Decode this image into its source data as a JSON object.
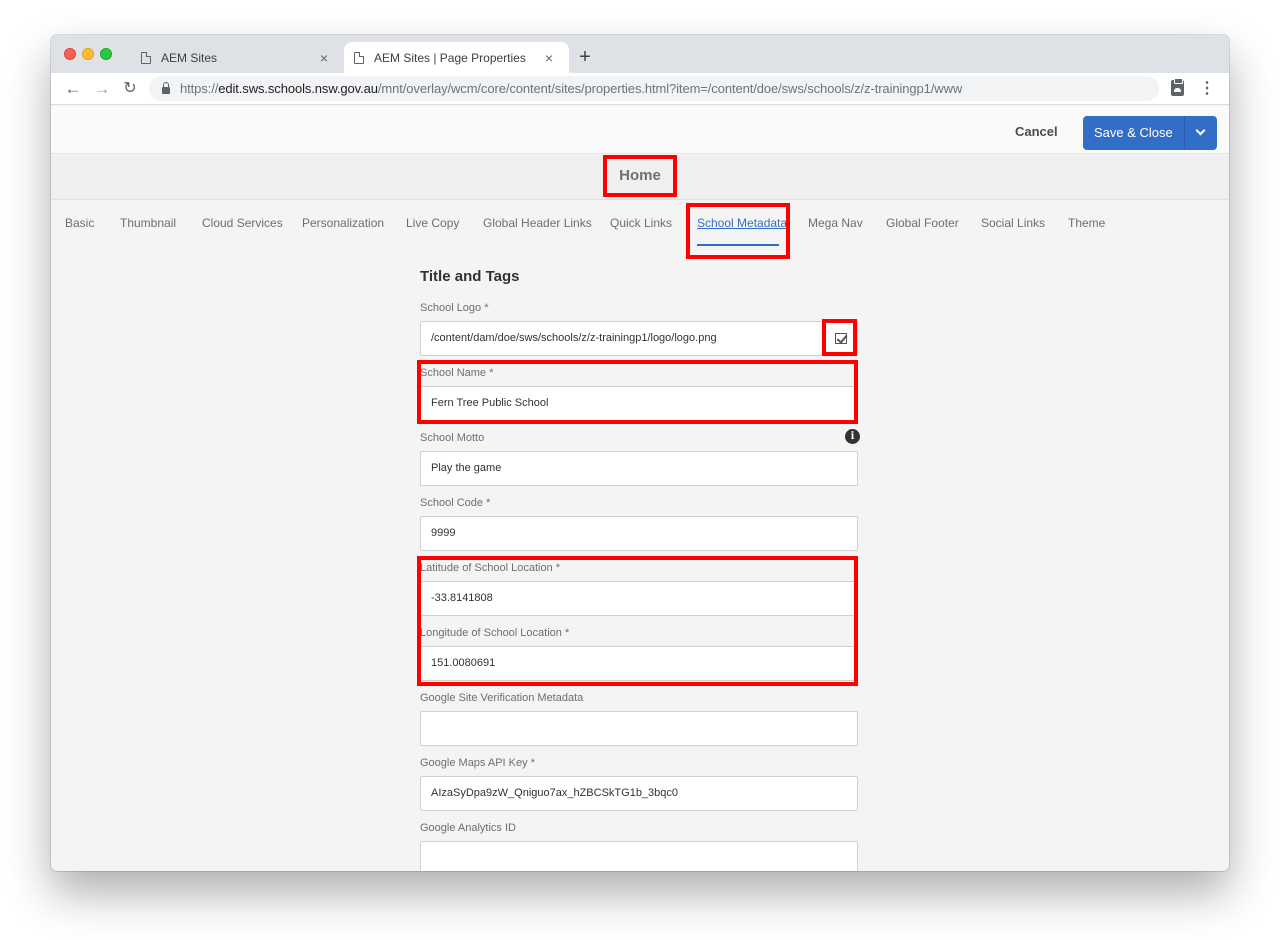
{
  "browser": {
    "tabs": [
      {
        "label": "AEM Sites",
        "active": false
      },
      {
        "label": "AEM Sites | Page Properties",
        "active": true
      }
    ],
    "new_tab": "+",
    "close_glyph": "×",
    "nav": {
      "back": "←",
      "forward": "→",
      "reload": "C"
    },
    "url": {
      "scheme": "https://",
      "host": "edit.sws.schools.nsw.gov.au",
      "path": "/mnt/overlay/wcm/core/content/sites/properties.html?item=/content/doe/sws/schools/z/z-trainingp1/www"
    },
    "menu_glyph": "⋮"
  },
  "header": {
    "cancel_label": "Cancel",
    "save_label": "Save & Close",
    "accent_color": "#326ec8"
  },
  "page_title": "Home",
  "property_tabs": [
    {
      "label": "Basic"
    },
    {
      "label": "Thumbnail"
    },
    {
      "label": "Cloud Services"
    },
    {
      "label": "Personalization"
    },
    {
      "label": "Live Copy"
    },
    {
      "label": "Global Header Links"
    },
    {
      "label": "Quick Links"
    },
    {
      "label": "School Metadata",
      "selected": true
    },
    {
      "label": "Mega Nav"
    },
    {
      "label": "Global Footer"
    },
    {
      "label": "Social Links"
    },
    {
      "label": "Theme"
    }
  ],
  "form": {
    "section_title": "Title and Tags",
    "fields": {
      "school_logo": {
        "label": "School Logo *",
        "value": "/content/dam/doe/sws/schools/z/z-trainingp1/logo/logo.png"
      },
      "school_name": {
        "label": "School Name *",
        "value": "Fern Tree Public School"
      },
      "school_motto": {
        "label": "School Motto",
        "value": "Play the game"
      },
      "school_code": {
        "label": "School Code *",
        "value": "9999"
      },
      "latitude": {
        "label": "Latitude of School Location *",
        "value": "-33.8141808"
      },
      "longitude": {
        "label": "Longitude of School Location *",
        "value": "151.0080691"
      },
      "site_verification": {
        "label": "Google Site Verification Metadata",
        "value": ""
      },
      "maps_api_key": {
        "label": "Google Maps API Key *",
        "value": "AIzaSyDpa9zW_Qniguo7ax_hZBCSkTG1b_3bqc0"
      },
      "analytics_id": {
        "label": "Google Analytics ID",
        "value": ""
      }
    }
  },
  "annotation_color": "#ff0000"
}
